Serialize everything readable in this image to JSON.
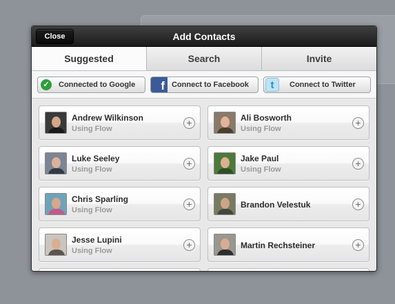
{
  "modal": {
    "title": "Add Contacts",
    "close_label": "Close"
  },
  "tabs": [
    {
      "label": "Suggested",
      "active": true
    },
    {
      "label": "Search",
      "active": false
    },
    {
      "label": "Invite",
      "active": false
    }
  ],
  "connect": {
    "google": {
      "label": "Connected to Google",
      "icon": "check-icon",
      "color": "#2e9e3a"
    },
    "facebook": {
      "label": "Connect to Facebook",
      "icon": "facebook-icon",
      "color": "#3b5b98"
    },
    "twitter": {
      "label": "Connect to Twitter",
      "icon": "twitter-icon",
      "color": "#2a8ec6"
    }
  },
  "contacts": [
    {
      "name": "Andrew Wilkinson",
      "sub": "Using Flow"
    },
    {
      "name": "Ali Bosworth",
      "sub": "Using Flow"
    },
    {
      "name": "Luke Seeley",
      "sub": "Using Flow"
    },
    {
      "name": "Jake Paul",
      "sub": "Using Flow"
    },
    {
      "name": "Chris Sparling",
      "sub": "Using Flow"
    },
    {
      "name": "Brandon Velestuk",
      "sub": ""
    },
    {
      "name": "Jesse Lupini",
      "sub": "Using Flow"
    },
    {
      "name": "Martin Rechsteiner",
      "sub": ""
    }
  ]
}
